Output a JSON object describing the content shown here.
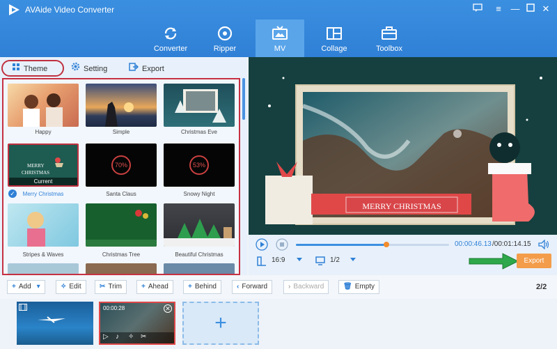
{
  "app": {
    "title": "AVAide Video Converter"
  },
  "nav": {
    "tabs": [
      {
        "label": "Converter",
        "icon": "refresh-icon"
      },
      {
        "label": "Ripper",
        "icon": "disc-icon"
      },
      {
        "label": "MV",
        "icon": "tv-icon",
        "active": true
      },
      {
        "label": "Collage",
        "icon": "grid-icon"
      },
      {
        "label": "Toolbox",
        "icon": "toolbox-icon"
      }
    ]
  },
  "subtabs": {
    "theme": "Theme",
    "setting": "Setting",
    "export": "Export"
  },
  "themes": [
    {
      "label": "Happy"
    },
    {
      "label": "Simple"
    },
    {
      "label": "Christmas Eve"
    },
    {
      "label": "Merry Christmas",
      "selected": true,
      "current_label": "Current",
      "thumb_text": "MERRY CHRISTMAS"
    },
    {
      "label": "Santa Claus",
      "percent": "70%"
    },
    {
      "label": "Snowy Night",
      "percent": "53%"
    },
    {
      "label": "Stripes & Waves"
    },
    {
      "label": "Christmas Tree"
    },
    {
      "label": "Beautiful Christmas"
    }
  ],
  "preview": {
    "banner_text": "MERRY CHRISTMAS",
    "current_time": "00:00:46.13",
    "total_time": "/00:01:14.15",
    "progress": 0.59,
    "aspect_ratio": "16:9",
    "page": "1/2",
    "export_label": "Export"
  },
  "toolbar": {
    "add": "Add",
    "edit": "Edit",
    "trim": "Trim",
    "ahead": "Ahead",
    "behind": "Behind",
    "forward": "Forward",
    "backward": "Backward",
    "empty": "Empty",
    "count": "2/2"
  },
  "timeline": {
    "clip2_time": "00:00:28",
    "add_symbol": "+"
  },
  "colors": {
    "accent": "#2f80d6",
    "export": "#f39c4a",
    "highlight": "#c63042"
  }
}
